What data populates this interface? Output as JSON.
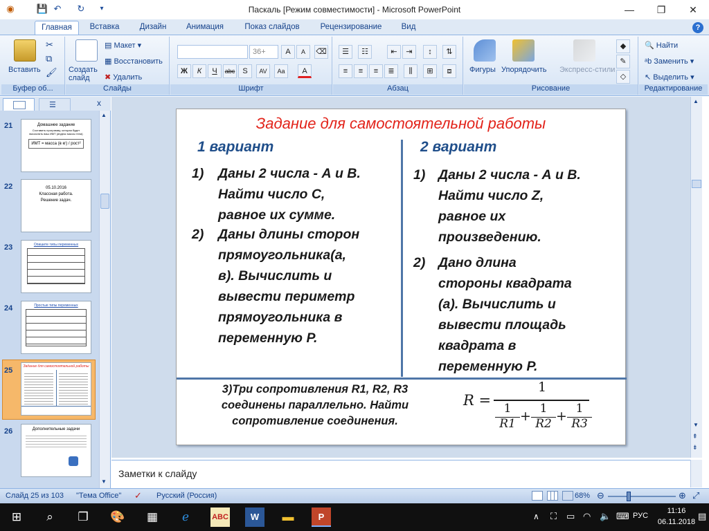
{
  "window": {
    "title": "Паскаль [Режим совместимости] - Microsoft PowerPoint"
  },
  "tabs": [
    "Главная",
    "Вставка",
    "Дизайн",
    "Анимация",
    "Показ слайдов",
    "Рецензирование",
    "Вид"
  ],
  "ribbon": {
    "clipboard": {
      "paste": "Вставить",
      "group": "Буфер об..."
    },
    "slides": {
      "new_slide": "Создать слайд",
      "layout": "Макет",
      "reset": "Восстановить",
      "delete": "Удалить",
      "group": "Слайды"
    },
    "font": {
      "size": "36+",
      "group": "Шрифт"
    },
    "paragraph": {
      "group": "Абзац"
    },
    "drawing": {
      "shapes": "Фигуры",
      "arrange": "Упорядочить",
      "quick_styles": "Экспресс-стили",
      "group": "Рисование"
    },
    "editing": {
      "find": "Найти",
      "replace": "Заменить",
      "select": "Выделить",
      "group": "Редактирование"
    }
  },
  "thumbnails": [
    {
      "num": "21",
      "title": "Домашнее задание",
      "text": "Составить программу, которая будет вычислять ваш ИМТ (индекс массы тела)",
      "formula": "ИМТ = масса (в кг) / рост²"
    },
    {
      "num": "22",
      "text": "05.10.2016\nКлассная работа.\nРешение задач."
    },
    {
      "num": "23",
      "title": "Опишите типы переменных"
    },
    {
      "num": "24",
      "title": "Простые типы переменных"
    },
    {
      "num": "25",
      "title": "Задание для самостоятельной работы"
    },
    {
      "num": "26",
      "title": "Дополнительные задачи"
    }
  ],
  "slide": {
    "title": "Задание для самостоятельной работы",
    "variant1": {
      "heading": "1 вариант",
      "items": [
        {
          "n": "1)",
          "lines": [
            "Даны 2 числа  - А и В.",
            "Найти  число С,",
            "равное их сумме."
          ]
        },
        {
          "n": "2)",
          "lines": [
            "Даны длины сторон",
            "прямоугольника(а,",
            "в). Вычислить и",
            "вывести периметр",
            "прямоугольника в",
            "переменную Р."
          ]
        }
      ]
    },
    "variant2": {
      "heading": "2 вариант",
      "items": [
        {
          "n": "1)",
          "lines": [
            "Даны 2 числа  - А и В.",
            "Найти число Z,",
            "равное их",
            "произведению."
          ]
        },
        {
          "n": "2)",
          "lines": [
            "Дано длина",
            "стороны квадрата",
            "(а). Вычислить и",
            "вывести площадь",
            "квадрата в",
            "переменную Р."
          ]
        }
      ]
    },
    "task3": {
      "lines": [
        "3)Три сопротивления R1, R2, R3",
        "соединены параллельно. Найти",
        "сопротивление соединения."
      ]
    },
    "formula": {
      "lhs": "R =",
      "num": "1",
      "t1": "1",
      "b1": "R1",
      "t2": "1",
      "b2": "R2",
      "t3": "1",
      "b3": "R3",
      "plus": "+"
    }
  },
  "notes": {
    "placeholder": "Заметки к слайду"
  },
  "status": {
    "slide": "Слайд 25 из 103",
    "theme": "\"Тема Office\"",
    "lang": "Русский (Россия)",
    "zoom": "68%"
  },
  "taskbar": {
    "lang": "РУС",
    "time": "11:16",
    "date": "06.11.2018"
  },
  "colors": {
    "accent": "#15428b",
    "title_red": "#e2231a",
    "variant_blue": "#1f4e8a",
    "divider": "#4f76a8"
  }
}
